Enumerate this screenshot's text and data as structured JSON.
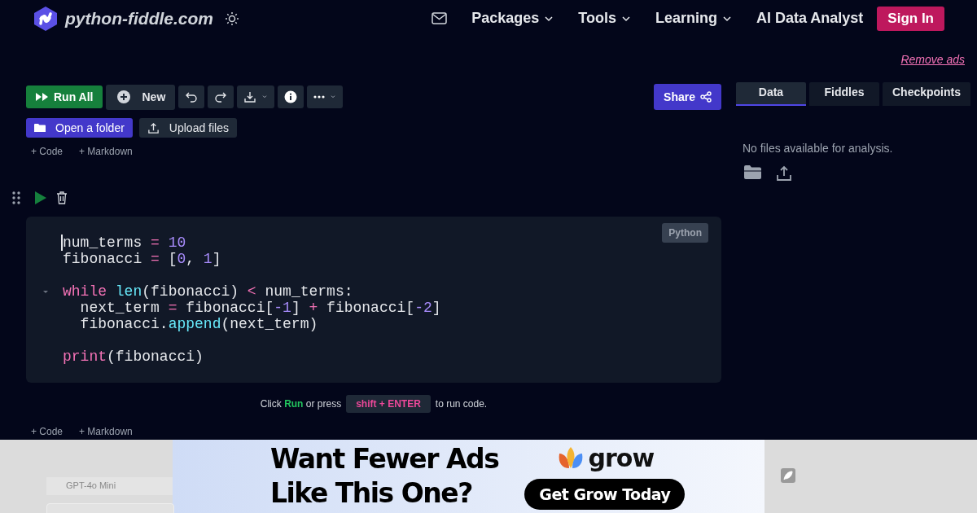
{
  "header": {
    "brand": "python-fiddle.com",
    "nav": [
      {
        "label": "Packages",
        "dropdown": true
      },
      {
        "label": "Tools",
        "dropdown": true
      },
      {
        "label": "Learning",
        "dropdown": true
      },
      {
        "label": "AI Data Analyst",
        "dropdown": false
      }
    ],
    "sign_in": "Sign In"
  },
  "remove_ads": "Remove ads",
  "toolbar": {
    "run_all": "Run All",
    "new": "New",
    "share": "Share"
  },
  "file_buttons": {
    "open_folder": "Open a folder",
    "upload": "Upload files"
  },
  "add_cell_top": [
    "+ Code",
    "+ Markdown"
  ],
  "cell": {
    "language": "Python",
    "lines": [
      {
        "kind": "code",
        "cursor": true,
        "foldable": false,
        "tokens": [
          {
            "text": "num_terms",
            "kind": "plain"
          },
          {
            "text": " = ",
            "kind": "op"
          },
          {
            "text": "10",
            "kind": "num"
          }
        ]
      },
      {
        "kind": "code",
        "cursor": false,
        "foldable": false,
        "tokens": [
          {
            "text": "fibonacci",
            "kind": "plain"
          },
          {
            "text": " = ",
            "kind": "op"
          },
          {
            "text": "[",
            "kind": "plain"
          },
          {
            "text": "0",
            "kind": "num"
          },
          {
            "text": ", ",
            "kind": "plain"
          },
          {
            "text": "1",
            "kind": "num"
          },
          {
            "text": "]",
            "kind": "plain"
          }
        ]
      },
      {
        "kind": "blank"
      },
      {
        "kind": "code",
        "cursor": false,
        "foldable": true,
        "tokens": [
          {
            "text": "while",
            "kind": "kw"
          },
          {
            "text": " len",
            "kind": "fn"
          },
          {
            "text": "(fibonacci) ",
            "kind": "plain"
          },
          {
            "text": "<",
            "kind": "op"
          },
          {
            "text": " num_terms:",
            "kind": "plain"
          }
        ]
      },
      {
        "kind": "code",
        "cursor": false,
        "foldable": false,
        "tokens": [
          {
            "text": "  next_term",
            "kind": "plain"
          },
          {
            "text": " = ",
            "kind": "op"
          },
          {
            "text": "fibonacci[",
            "kind": "plain"
          },
          {
            "text": "-1",
            "kind": "num"
          },
          {
            "text": "] ",
            "kind": "plain"
          },
          {
            "text": "+",
            "kind": "op"
          },
          {
            "text": " fibonacci[",
            "kind": "plain"
          },
          {
            "text": "-2",
            "kind": "num"
          },
          {
            "text": "]",
            "kind": "plain"
          }
        ]
      },
      {
        "kind": "code",
        "cursor": false,
        "foldable": false,
        "tokens": [
          {
            "text": "  fibonacci.",
            "kind": "plain"
          },
          {
            "text": "append",
            "kind": "fn"
          },
          {
            "text": "(next_term)",
            "kind": "plain"
          }
        ]
      },
      {
        "kind": "blank"
      },
      {
        "kind": "code",
        "cursor": false,
        "foldable": false,
        "tokens": [
          {
            "text": "print",
            "kind": "kw"
          },
          {
            "text": "(fibonacci)",
            "kind": "plain"
          }
        ]
      }
    ]
  },
  "hint": {
    "before": "Click **Run** or press",
    "key": "shift + ENTER",
    "after": "to run code."
  },
  "add_cell_bottom": [
    "+ Code",
    "+ Markdown"
  ],
  "side_panel": {
    "tabs": [
      {
        "label": "Data",
        "selected": true
      },
      {
        "label": "Fiddles",
        "selected": false
      },
      {
        "label": "Checkpoints",
        "selected": false
      }
    ],
    "empty_message": "No files available for analysis."
  },
  "ad": {
    "model_label": "GPT-4o Mini",
    "headline_1": "Want Fewer Ads",
    "headline_2": "Like This One?",
    "logo": "grow",
    "cta": "Get Grow Today"
  }
}
